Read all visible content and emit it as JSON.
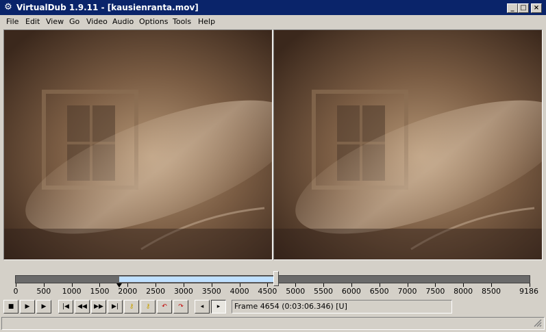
{
  "window": {
    "title": "VirtualDub 1.9.11 - [kausienranta.mov]",
    "app_icon": "virtualdub-logo-icon",
    "controls": [
      "_",
      "□",
      "×"
    ]
  },
  "menu": [
    "File",
    "Edit",
    "View",
    "Go",
    "Video",
    "Audio",
    "Options",
    "Tools",
    "Help"
  ],
  "panes": {
    "input": "input-video-pane",
    "output": "output-video-pane"
  },
  "timeline": {
    "total_frames": 9186,
    "current_frame": 4654,
    "selection_start": 1850,
    "selection_end": 4654,
    "ticks": [
      "0",
      "500",
      "1000",
      "1500",
      "2000",
      "2500",
      "3000",
      "3500",
      "4000",
      "4500",
      "5000",
      "5500",
      "6000",
      "6500",
      "7000",
      "7500",
      "8000",
      "8500",
      "9186"
    ]
  },
  "toolbar": {
    "buttons": [
      {
        "name": "stop-button",
        "icon": "stop-icon",
        "glyph": "■"
      },
      {
        "name": "play-input-button",
        "icon": "play-input-icon",
        "glyph": "▶"
      },
      {
        "name": "play-output-button",
        "icon": "play-output-icon",
        "glyph": "▶"
      },
      {
        "name": "go-start-button",
        "icon": "go-start-icon",
        "glyph": "|◀"
      },
      {
        "name": "prev-frame-button",
        "icon": "prev-frame-icon",
        "glyph": "◀◀"
      },
      {
        "name": "next-frame-button",
        "icon": "next-frame-icon",
        "glyph": "▶▶"
      },
      {
        "name": "go-end-button",
        "icon": "go-end-icon",
        "glyph": "▶|"
      },
      {
        "name": "prev-key-button",
        "icon": "prev-key-icon",
        "glyph": "⚷"
      },
      {
        "name": "next-key-button",
        "icon": "next-key-icon",
        "glyph": "⚷"
      },
      {
        "name": "prev-scene-button",
        "icon": "prev-scene-icon",
        "glyph": "↶"
      },
      {
        "name": "next-scene-button",
        "icon": "next-scene-icon",
        "glyph": "↷"
      },
      {
        "name": "mark-in-button",
        "icon": "mark-in-icon",
        "glyph": "◂"
      },
      {
        "name": "mark-out-button",
        "icon": "mark-out-icon",
        "glyph": "▸"
      }
    ]
  },
  "frame_status": "Frame 4654 (0:03:06.346) [U]",
  "colors": {
    "titlebar": "#0a246a",
    "selection": "#bfe0ff",
    "track": "#6a6a6a",
    "chrome": "#d4d0c8"
  }
}
